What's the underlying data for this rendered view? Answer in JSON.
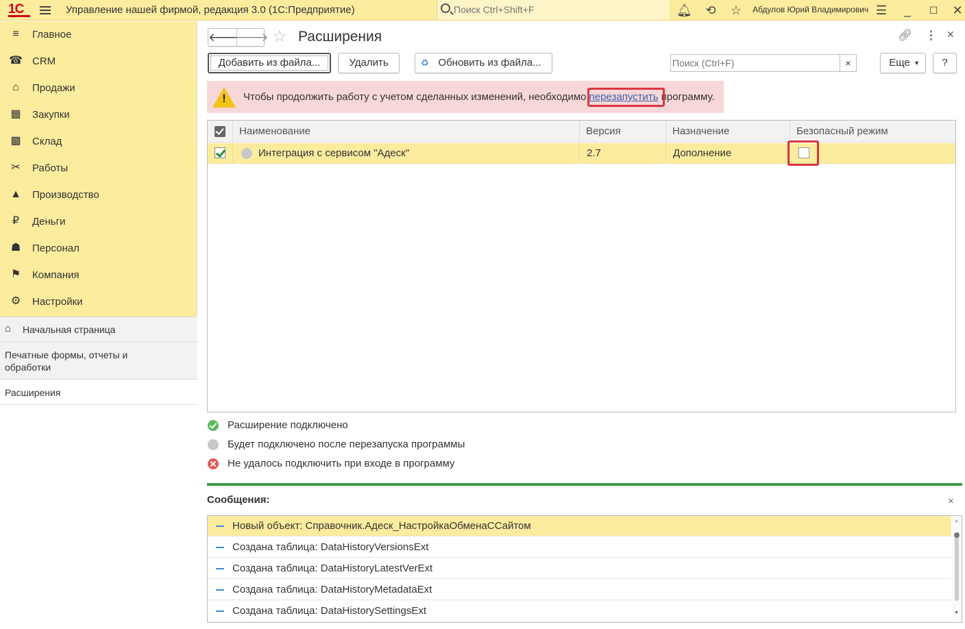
{
  "topbar": {
    "logo_text": "1С",
    "app_title": "Управление нашей фирмой, редакция 3.0  (1С:Предприятие)",
    "search_placeholder": "Поиск Ctrl+Shift+F",
    "user_name": "Абдулов Юрий Владимирович",
    "icons": [
      "bell-icon",
      "history-icon",
      "star-icon",
      "menu-lines-icon",
      "minimize-icon",
      "maximize-icon",
      "close-icon"
    ]
  },
  "sidebar": {
    "items": [
      {
        "label": "Главное",
        "icon": "≡"
      },
      {
        "label": "CRM",
        "icon": "☎"
      },
      {
        "label": "Продажи",
        "icon": "⌂"
      },
      {
        "label": "Закупки",
        "icon": "▦"
      },
      {
        "label": "Склад",
        "icon": "▩"
      },
      {
        "label": "Работы",
        "icon": "✂"
      },
      {
        "label": "Производство",
        "icon": "▲"
      },
      {
        "label": "Деньги",
        "icon": "₽"
      },
      {
        "label": "Персонал",
        "icon": "☗"
      },
      {
        "label": "Компания",
        "icon": "⚑"
      },
      {
        "label": "Настройки",
        "icon": "⚙"
      }
    ],
    "open_windows": [
      {
        "label": "Начальная страница"
      },
      {
        "label": "Печатные формы, отчеты и обработки"
      },
      {
        "label": "Расширения"
      }
    ]
  },
  "page": {
    "title": "Расширения",
    "back": "🡐",
    "forward": "🡒",
    "buttons": {
      "add_from_file": "Добавить из файла...",
      "delete": "Удалить",
      "update_from_file": "Обновить из файла...",
      "more": "Еще",
      "help": "?"
    },
    "search_placeholder": "Поиск (Ctrl+F)",
    "search_clear": "×"
  },
  "warning": {
    "text_before": "Чтобы продолжить работу с учетом сделанных изменений, необходимо ",
    "link": "перезапустить",
    "text_after": " программу."
  },
  "table": {
    "columns": [
      "Наименование",
      "Версия",
      "Назначение",
      "Безопасный режим"
    ],
    "rows": [
      {
        "checked": true,
        "status": "pending",
        "name": "Интеграция с сервисом \"Адеск\"",
        "version": "2.7",
        "purpose": "Дополнение",
        "safe_mode": false
      }
    ]
  },
  "legend": [
    {
      "status": "connected",
      "text": "Расширение подключено"
    },
    {
      "status": "pending",
      "text": "Будет подключено после перезапуска программы"
    },
    {
      "status": "failed",
      "text": "Не удалось подключить при входе в программу"
    }
  ],
  "messages": {
    "title": "Сообщения:",
    "close": "×",
    "items": [
      "Новый объект: Справочник.Адеск_НастройкаОбменаССайтом",
      "Создана таблица: DataHistoryVersionsExt",
      "Создана таблица: DataHistoryLatestVerExt",
      "Создана таблица: DataHistoryMetadataExt",
      "Создана таблица: DataHistorySettingsExt"
    ]
  },
  "colors": {
    "accent_yellow": "#fbec9e",
    "warning_bg": "#f8d7d8",
    "link": "#3b5ea8",
    "highlight": "#d9373f",
    "status_connected": "#5cb85c",
    "status_pending": "#c8c8c8",
    "status_failed": "#e05a5a"
  }
}
